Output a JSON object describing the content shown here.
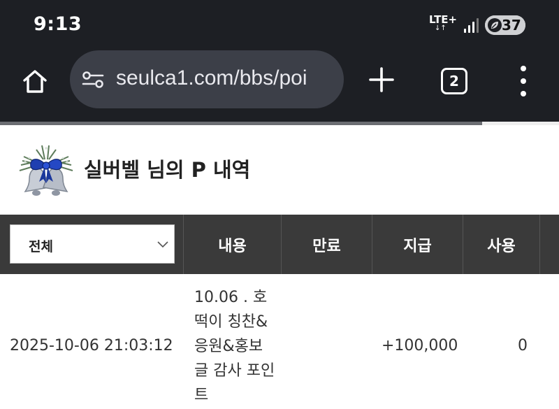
{
  "status_bar": {
    "time": "9:13",
    "network": "LTE+",
    "network_arrows": "↓↑",
    "battery_level": "37"
  },
  "browser": {
    "url": "seulca1.com/bbs/poi",
    "tab_count": "2"
  },
  "page": {
    "title": "실버벨 님의 P 내역"
  },
  "table": {
    "filter": {
      "selected": "전체"
    },
    "columns": {
      "content": "내용",
      "expire": "만료",
      "grant": "지급",
      "use": "사용"
    },
    "rows": [
      {
        "date": "2025-10-06 21:03:12",
        "content": "10.06 . 호떡이 칭찬&응원&홍보글 감사 포인트",
        "expire": "",
        "grant": "+100,000",
        "use": "0"
      }
    ]
  },
  "colors": {
    "browser_bg": "#1d1f24",
    "urlbar_bg": "#3c3f48",
    "table_header_bg": "#3a3a3a"
  },
  "icons": [
    "home-icon",
    "site-settings-icon",
    "plus-icon",
    "tabs-icon",
    "more-vert-icon",
    "bell-icon",
    "chevron-down-icon",
    "signal-icon",
    "battery-icon"
  ]
}
